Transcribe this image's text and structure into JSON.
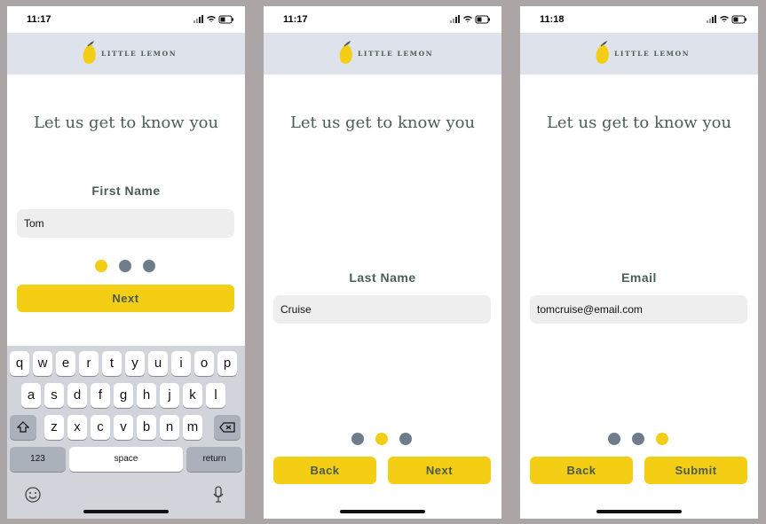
{
  "colors": {
    "primary_yellow": "#f4ce14",
    "header_bg": "#dee2eb",
    "text_green": "#4a5e56",
    "dot_inactive": "#6d7d8c",
    "page_bg": "#aba6a5"
  },
  "app": {
    "logo_text": "LITTLE LEMON",
    "welcome": "Let us get to know you"
  },
  "screens": [
    {
      "time": "11:17",
      "field_label": "First Name",
      "field_value": "Tom",
      "dots": [
        "active",
        "inactive",
        "inactive"
      ],
      "next_label": "Next"
    },
    {
      "time": "11:17",
      "field_label": "Last Name",
      "field_value": "Cruise",
      "dots": [
        "inactive",
        "active",
        "inactive"
      ],
      "back_label": "Back",
      "next_label": "Next"
    },
    {
      "time": "11:18",
      "field_label": "Email",
      "field_value": "tomcruise@email.com",
      "dots": [
        "inactive",
        "inactive",
        "active"
      ],
      "back_label": "Back",
      "submit_label": "Submit"
    }
  ],
  "keyboard": {
    "row1": [
      "q",
      "w",
      "e",
      "r",
      "t",
      "y",
      "u",
      "i",
      "o",
      "p"
    ],
    "row2": [
      "a",
      "s",
      "d",
      "f",
      "g",
      "h",
      "j",
      "k",
      "l"
    ],
    "row3": [
      "z",
      "x",
      "c",
      "v",
      "b",
      "n",
      "m"
    ],
    "numbers_label": "123",
    "space_label": "space",
    "return_label": "return"
  }
}
